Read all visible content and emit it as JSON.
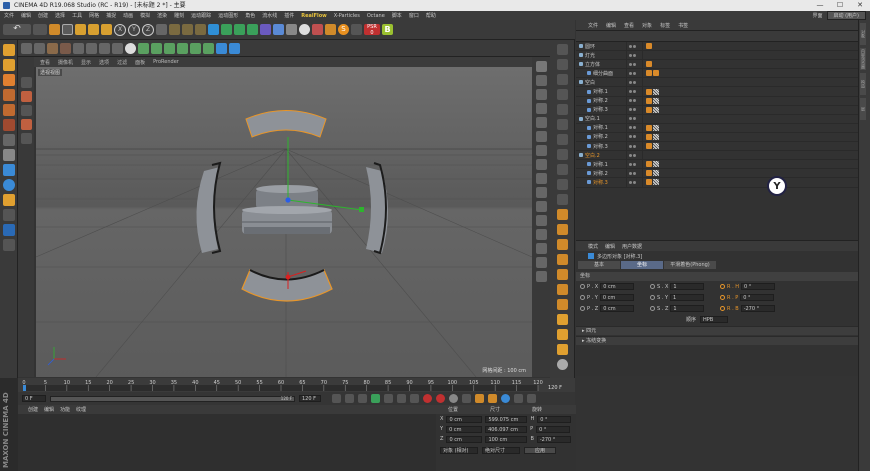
{
  "window": {
    "title": "CINEMA 4D R19.068 Studio (RC - R19) - [未标题 2 *] - 主要",
    "controls": [
      "—",
      "☐",
      "✕"
    ]
  },
  "menu": [
    "文件",
    "编辑",
    "创建",
    "选择",
    "工具",
    "网格",
    "捕捉",
    "动画",
    "模拟",
    "渲染",
    "雕刻",
    "运动跟踪",
    "运动图形",
    "角色",
    "流水线",
    "插件",
    "RealFlow",
    "X-Particles",
    "Octane",
    "脚本",
    "窗口",
    "帮助"
  ],
  "menu_highlight": "RealFlow",
  "layout": {
    "label": "界面",
    "value": "启动 (用户)"
  },
  "toolbar1": {
    "undo_icon": "undo-icon",
    "axis_x": "X",
    "axis_y": "Y",
    "axis_z": "Z",
    "psr_label": "PSR",
    "psr_value": "0"
  },
  "viewport": {
    "menu": [
      "查看",
      "摄像机",
      "显示",
      "选项",
      "过滤",
      "面板",
      "ProRender"
    ],
    "camera_label": "透视视图",
    "grid_spacing": "网格间距 : 100 cm",
    "colors": {
      "bg_top": "#6e6e6e",
      "floor": "#5b5b5b",
      "object": "#8a8e94",
      "selected_outline": "#e8962a"
    }
  },
  "object_manager": {
    "tabs": [
      "文件",
      "编辑",
      "查看",
      "对象",
      "标签",
      "书签"
    ],
    "rows": [
      {
        "name": "圆环",
        "indent": 0,
        "tags": "c"
      },
      {
        "name": "灯光",
        "indent": 0,
        "tags": "none"
      },
      {
        "name": "立方体",
        "indent": 0,
        "tags": "c"
      },
      {
        "name": "细分曲面",
        "indent": 1,
        "tags": "cc"
      },
      {
        "name": "空白",
        "indent": 0,
        "tags": "none"
      },
      {
        "name": "对称.1",
        "indent": 1,
        "tags": "cg"
      },
      {
        "name": "对称.2",
        "indent": 1,
        "tags": "cg"
      },
      {
        "name": "对称.3",
        "indent": 1,
        "tags": "cg"
      },
      {
        "name": "空白.1",
        "indent": 0,
        "tags": "none"
      },
      {
        "name": "对称.1",
        "indent": 1,
        "tags": "cg"
      },
      {
        "name": "对称.2",
        "indent": 1,
        "tags": "cg"
      },
      {
        "name": "对称.3",
        "indent": 1,
        "tags": "cg"
      },
      {
        "name": "空白.2",
        "indent": 0,
        "tags": "none",
        "highlight": true
      },
      {
        "name": "对称.1",
        "indent": 1,
        "tags": "cg"
      },
      {
        "name": "对称.2",
        "indent": 1,
        "tags": "cg"
      },
      {
        "name": "对称.3",
        "indent": 1,
        "tags": "cg",
        "highlight": true
      }
    ]
  },
  "attributes": {
    "tabs": [
      "模式",
      "编辑",
      "用户数据"
    ],
    "object_title": "多边形对象 [对称.3]",
    "buttons": [
      "基本",
      "坐标",
      "平滑着色(Phong)"
    ],
    "selected_button": "坐标",
    "section": "坐标",
    "rows": [
      {
        "p_label": "P . X",
        "p": "0 cm",
        "s_label": "S . X",
        "s": "1",
        "r_label": "R . H",
        "r": "0 °"
      },
      {
        "p_label": "P . Y",
        "p": "0 cm",
        "s_label": "S . Y",
        "s": "1",
        "r_label": "R . P",
        "r": "0 °"
      },
      {
        "p_label": "P . Z",
        "p": "0 cm",
        "s_label": "S . Z",
        "s": "1",
        "r_label": "R . B",
        "r": "-270 °"
      }
    ],
    "order_label": "顺序",
    "order_value": "HPB",
    "collapsed": [
      "四元",
      "冻结变换"
    ]
  },
  "side_tabs": [
    "对象",
    "内容浏览器",
    "构造",
    "层"
  ],
  "timeline": {
    "ticks": [
      "0",
      "5",
      "10",
      "15",
      "20",
      "25",
      "30",
      "35",
      "40",
      "45",
      "50",
      "55",
      "60",
      "65",
      "70",
      "75",
      "80",
      "85",
      "90",
      "95",
      "100",
      "105",
      "110",
      "115",
      "120"
    ],
    "end_label": "120 F",
    "current": "0 F",
    "start": "0 F",
    "end": "120 F",
    "end2": "120 F"
  },
  "material_manager": {
    "tabs": [
      "创建",
      "编辑",
      "功能",
      "纹理"
    ]
  },
  "coordinates": {
    "headers": [
      "位置",
      "尺寸",
      "旋转"
    ],
    "rows": [
      {
        "axis": "X",
        "pos": "0 cm",
        "size": "599.075 cm",
        "rot_axis": "H",
        "rot": "0 °"
      },
      {
        "axis": "Y",
        "pos": "0 cm",
        "size": "406.097 cm",
        "rot_axis": "P",
        "rot": "0 °"
      },
      {
        "axis": "Z",
        "pos": "0 cm",
        "size": "100 cm",
        "rot_axis": "B",
        "rot": "-270 °"
      }
    ],
    "mode1": "对象 (相对)",
    "mode2": "绝对尺寸",
    "apply": "应用"
  },
  "brand": "MAXON CINEMA 4D"
}
